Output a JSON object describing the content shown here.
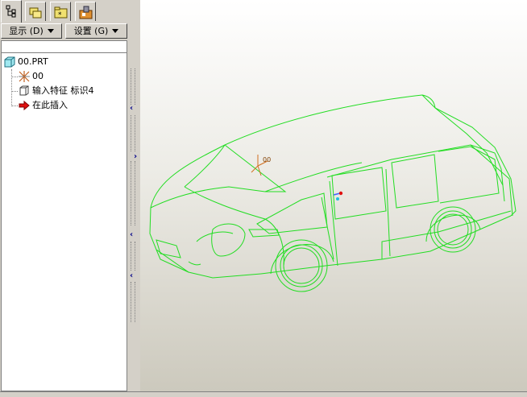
{
  "navigator_tabs": [
    {
      "name": "model-tree",
      "icon": "model-tree-icon",
      "active": true
    },
    {
      "name": "folder-browser",
      "icon": "folder-browser-icon",
      "active": false
    },
    {
      "name": "favorites",
      "icon": "favorites-icon",
      "active": false
    },
    {
      "name": "connections",
      "icon": "connections-icon",
      "active": false
    }
  ],
  "menus": {
    "show_label": "显示 (D)",
    "settings_label": "设置 (G)"
  },
  "tree": {
    "root_label": "00.PRT",
    "items": [
      {
        "label": "00",
        "icon": "coordinate-system-icon"
      },
      {
        "label": "输入特征 标识4",
        "icon": "import-feature-icon"
      },
      {
        "label": "在此插入",
        "icon": "insert-here-arrow-icon"
      }
    ]
  },
  "viewport": {
    "model_color": "#22dd22",
    "csys_label": "00",
    "background_top": "#ffffff",
    "background_bottom": "#ccc9bd"
  }
}
